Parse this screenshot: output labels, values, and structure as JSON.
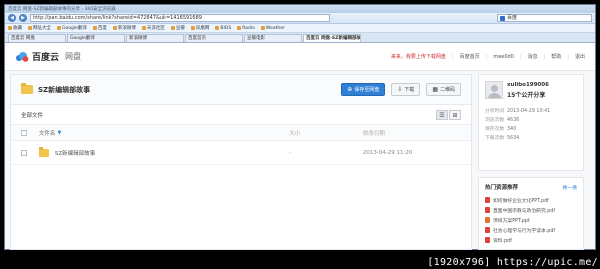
{
  "browser": {
    "title": "百度云 网盘-SZ新编辑部故事的分享 - 360安全浏览器",
    "address": "http://pan.baidu.com/share/link?shareid=472847&uk=1416591689",
    "search_value": "百度",
    "favorites": [
      "收藏",
      "网址大全",
      "Google翻译",
      "百度",
      "新浪微博",
      "天涯社区",
      "豆瓣",
      "凤凰网",
      "BIOS",
      "Radio",
      "Weather"
    ],
    "tabs": [
      {
        "label": "百度云 网盘"
      },
      {
        "label": "Google翻译"
      },
      {
        "label": "新浪微博"
      },
      {
        "label": "百度首页"
      },
      {
        "label": "豆瓣电影"
      },
      {
        "label": "百度云 网盘-SZ新编辑部故事..."
      }
    ]
  },
  "header": {
    "brand": "百度云",
    "sub": "网盘",
    "promo": "来来，我要上传下载网盘",
    "nav": [
      "百度首页",
      "mee0d0",
      "消息",
      "帮助",
      "退出"
    ]
  },
  "folder": {
    "title": "SZ新编辑部故事",
    "save_label": "保存至网盘",
    "download_label": "下载",
    "qrcode_label": "二维码"
  },
  "crumb": "全部文件",
  "table": {
    "headers": {
      "name": "文件名",
      "size": "大小",
      "date": "修改日期"
    },
    "rows": [
      {
        "name": "SZ新编辑部故事",
        "size": "-",
        "date": "2013-04-29 11:20"
      }
    ]
  },
  "user": {
    "name": "xulibo199006",
    "shares": "15个公开分享",
    "meta": [
      {
        "k": "分享时间",
        "v": "2013-04-29 10:41"
      },
      {
        "k": "浏览次数",
        "v": "4636"
      },
      {
        "k": "保存次数",
        "v": "340"
      },
      {
        "k": "下载次数",
        "v": "5634"
      }
    ]
  },
  "hot": {
    "title": "热门资源推荐",
    "more": "换一换",
    "items": [
      {
        "type": "pdf",
        "label": "如何做好企业文化PPT.pdf"
      },
      {
        "type": "pdf",
        "label": "直面中国宗教与政治研究.pdf"
      },
      {
        "type": "ppt",
        "label": "项目方案PPT.ppt"
      },
      {
        "type": "pdf",
        "label": "社会心理学与行为学读本.pdf"
      },
      {
        "type": "pdf",
        "label": "资料.pdf"
      }
    ]
  },
  "watermark": "[1920x796] https://upic.me/"
}
